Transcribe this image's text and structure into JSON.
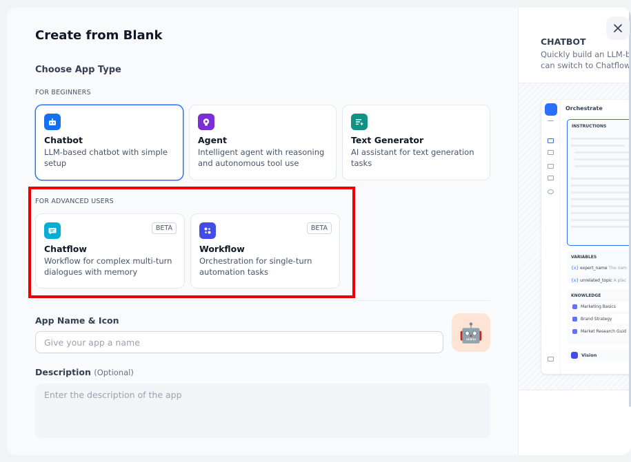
{
  "modal": {
    "title": "Create from Blank",
    "choose_label": "Choose App Type",
    "beginners_label": "FOR BEGINNERS",
    "advanced_label": "FOR ADVANCED USERS",
    "beginner_types": [
      {
        "name": "Chatbot",
        "desc": "LLM-based chatbot with simple setup",
        "icon": "chatbot-icon",
        "color": "#1570ef",
        "selected": true
      },
      {
        "name": "Agent",
        "desc": "Intelligent agent with reasoning and autonomous tool use",
        "icon": "agent-icon",
        "color": "#7a2ed6"
      },
      {
        "name": "Text Generator",
        "desc": "AI assistant for text generation tasks",
        "icon": "text-generator-icon",
        "color": "#0e9384"
      }
    ],
    "advanced_types": [
      {
        "name": "Chatflow",
        "desc": "Workflow for complex multi-turn dialogues with memory",
        "icon": "chatflow-icon",
        "color": "#06aed4",
        "badge": "BETA"
      },
      {
        "name": "Workflow",
        "desc": "Orchestration for single-turn automation tasks",
        "icon": "workflow-icon",
        "color": "#444ce7",
        "badge": "BETA"
      }
    ],
    "app_name_label": "App Name & Icon",
    "app_name_placeholder": "Give your app a name",
    "avatar_emoji": "🤖",
    "description_label": "Description",
    "description_optional": "(Optional)",
    "description_placeholder": "Enter the description of the app"
  },
  "preview": {
    "title": "CHATBOT",
    "desc_line1": "Quickly build an LLM-b",
    "desc_line2": "can switch to Chatflow",
    "mock": {
      "header": "Orchestrate",
      "instructions_label": "INSTRUCTIONS",
      "variables_label": "VARIABLES",
      "variables": [
        {
          "name": "expert_name",
          "hint": "The nam"
        },
        {
          "name": "unrelated_topic",
          "hint": "A plac"
        }
      ],
      "knowledge_label": "KNOWLEDGE",
      "knowledge": [
        "Marketing Basics",
        "Brand Strategy",
        "Market Research Guid"
      ],
      "vision_label": "Vision"
    }
  },
  "highlight_color": "#ee0000"
}
